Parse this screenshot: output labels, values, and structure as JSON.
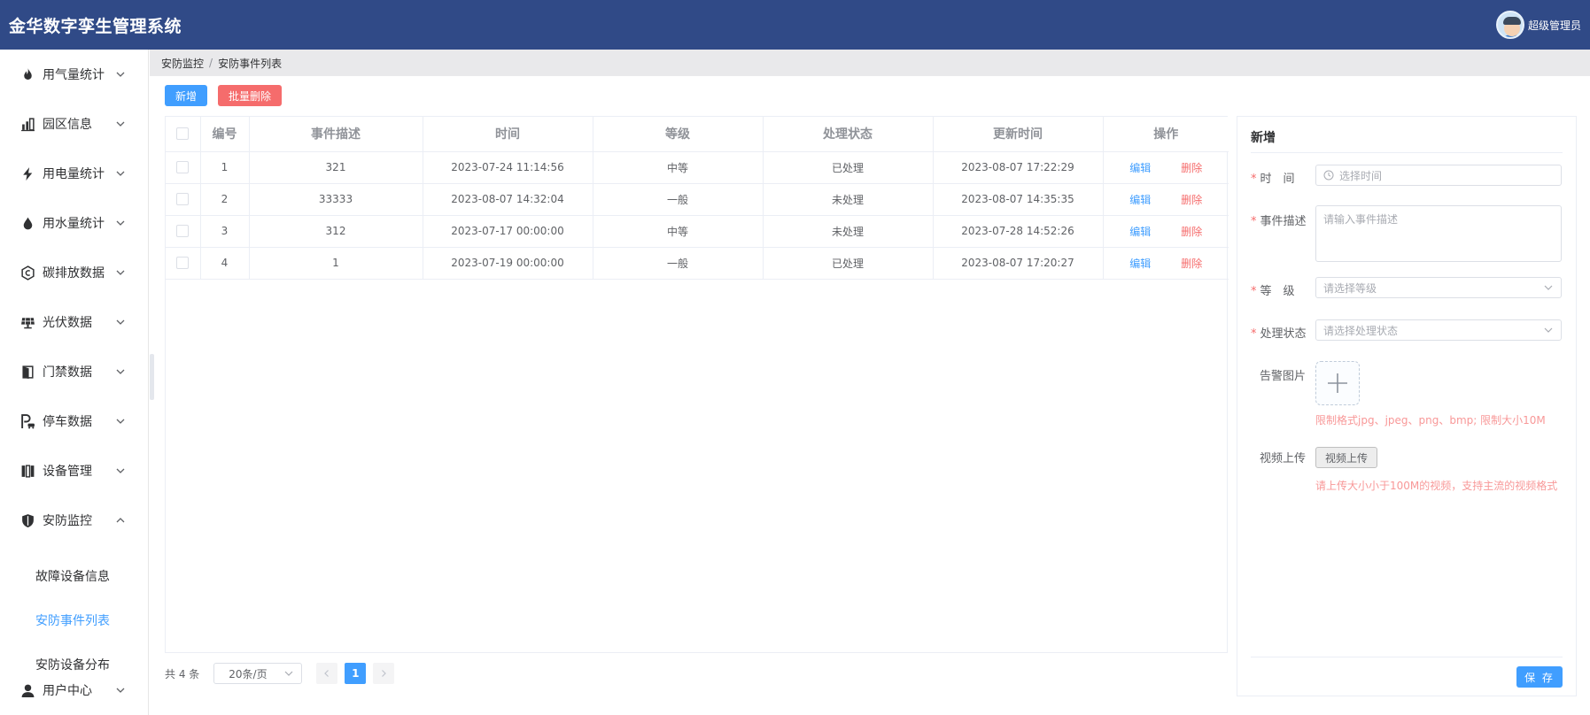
{
  "app": {
    "title": "金华数字孪生管理系统",
    "user": "超级管理员"
  },
  "sidebar": {
    "items": [
      {
        "label": "用气量统计",
        "icon": "flame-icon"
      },
      {
        "label": "园区信息",
        "icon": "building-chart-icon"
      },
      {
        "label": "用电量统计",
        "icon": "lightning-icon"
      },
      {
        "label": "用水量统计",
        "icon": "water-drop-icon"
      },
      {
        "label": "碳排放数据",
        "icon": "carbon-icon"
      },
      {
        "label": "光伏数据",
        "icon": "solar-panel-icon"
      },
      {
        "label": "门禁数据",
        "icon": "door-icon"
      },
      {
        "label": "停车数据",
        "icon": "parking-icon"
      },
      {
        "label": "设备管理",
        "icon": "device-icon"
      },
      {
        "label": "安防监控",
        "icon": "shield-icon",
        "expanded": true
      },
      {
        "label": "用户中心",
        "icon": "user-icon"
      }
    ],
    "sub_items": [
      {
        "label": "故障设备信息",
        "active": false
      },
      {
        "label": "安防事件列表",
        "active": true
      },
      {
        "label": "安防设备分布",
        "active": false
      }
    ]
  },
  "breadcrumb": {
    "parent": "安防监控",
    "separator": "/",
    "current": "安防事件列表"
  },
  "toolbar": {
    "add_label": "新增",
    "batch_delete_label": "批量删除"
  },
  "table": {
    "columns": [
      "编号",
      "事件描述",
      "时间",
      "等级",
      "处理状态",
      "更新时间",
      "操作"
    ],
    "rows": [
      {
        "id": "1",
        "desc": "321",
        "time": "2023-07-24 11:14:56",
        "level": "中等",
        "status": "已处理",
        "updated": "2023-08-07 17:22:29"
      },
      {
        "id": "2",
        "desc": "33333",
        "time": "2023-08-07 14:32:04",
        "level": "一般",
        "status": "未处理",
        "updated": "2023-08-07 14:35:35"
      },
      {
        "id": "3",
        "desc": "312",
        "time": "2023-07-17 00:00:00",
        "level": "中等",
        "status": "未处理",
        "updated": "2023-07-28 14:52:26"
      },
      {
        "id": "4",
        "desc": "1",
        "time": "2023-07-19 00:00:00",
        "level": "一般",
        "status": "已处理",
        "updated": "2023-08-07 17:20:27"
      }
    ],
    "edit_label": "编辑",
    "delete_label": "删除"
  },
  "pagination": {
    "total_text": "共 4 条",
    "page_size": "20条/页",
    "current_page": "1"
  },
  "form": {
    "title": "新增",
    "time_label": "时　间",
    "time_placeholder": "选择时间",
    "desc_label": "事件描述",
    "desc_placeholder": "请输入事件描述",
    "level_label": "等　级",
    "level_placeholder": "请选择等级",
    "status_label": "处理状态",
    "status_placeholder": "请选择处理状态",
    "image_label": "告警图片",
    "image_hint": "限制格式jpg、jpeg、png、bmp; 限制大小10M",
    "video_label": "视频上传",
    "video_button": "视频上传",
    "video_hint": "请上传大小小于100M的视频，支持主流的视频格式",
    "save_label": "保 存"
  },
  "colors": {
    "header": "#304a87",
    "primary": "#409eff",
    "danger": "#f56c6c",
    "hint": "#f89898"
  }
}
